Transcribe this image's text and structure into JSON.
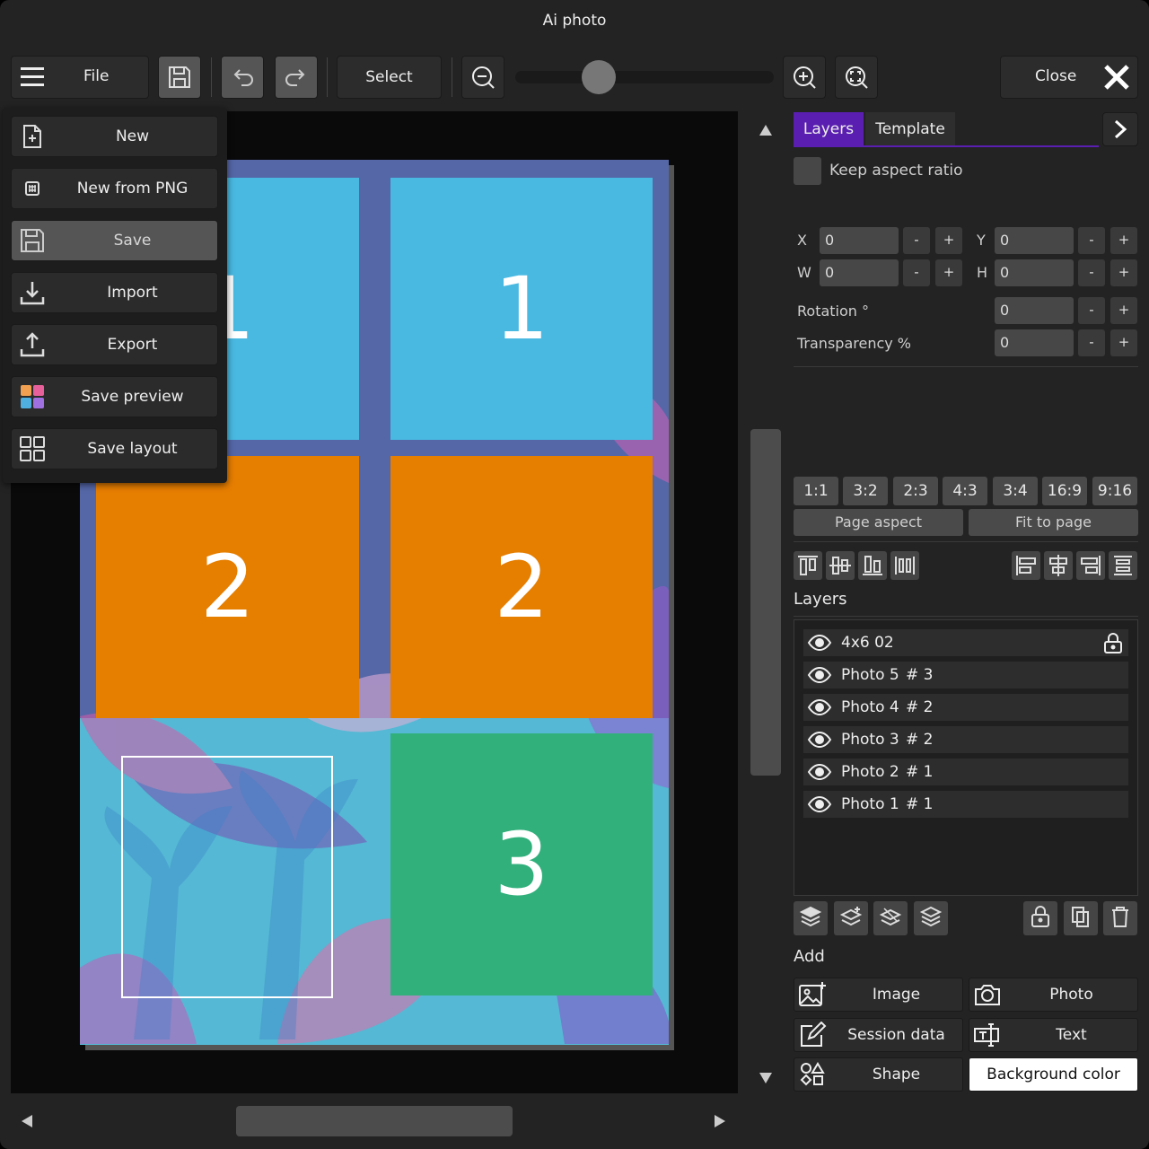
{
  "window": {
    "title": "Ai photo"
  },
  "toolbar": {
    "file_label": "File",
    "select_label": "Select",
    "close_label": "Close"
  },
  "file_menu": {
    "items": [
      "New",
      "New from PNG",
      "Save",
      "Import",
      "Export",
      "Save preview",
      "Save layout"
    ]
  },
  "canvas": {
    "cells": [
      "1",
      "1",
      "2",
      "2",
      "3"
    ],
    "colors": {
      "blue": "#49b9e1",
      "orange": "#e67e00",
      "green": "#31b07c",
      "background": "#5567a7"
    }
  },
  "panel": {
    "tabs": [
      "Layers",
      "Template"
    ],
    "keep_aspect_label": "Keep aspect ratio",
    "x_label": "X",
    "x_value": "0",
    "y_label": "Y",
    "y_value": "0",
    "w_label": "W",
    "w_value": "0",
    "h_label": "H",
    "h_value": "0",
    "rotation_label": "Rotation °",
    "rotation_value": "0",
    "transparency_label": "Transparency %",
    "transparency_value": "0",
    "minus": "-",
    "plus": "+",
    "ratios": [
      "1:1",
      "3:2",
      "2:3",
      "4:3",
      "3:4",
      "16:9",
      "9:16"
    ],
    "page_aspect_label": "Page aspect",
    "fit_to_page_label": "Fit to page",
    "layers_heading": "Layers",
    "add_heading": "Add"
  },
  "layers": [
    {
      "name": "4x6 02",
      "number": ""
    },
    {
      "name": "Photo 5",
      "number": "# 3"
    },
    {
      "name": "Photo 4",
      "number": "# 2"
    },
    {
      "name": "Photo 3",
      "number": "# 2"
    },
    {
      "name": "Photo 2",
      "number": "# 1"
    },
    {
      "name": "Photo 1",
      "number": "# 1"
    }
  ],
  "add": {
    "image": "Image",
    "photo": "Photo",
    "session_data": "Session data",
    "text": "Text",
    "shape": "Shape",
    "background_color": "Background color"
  }
}
